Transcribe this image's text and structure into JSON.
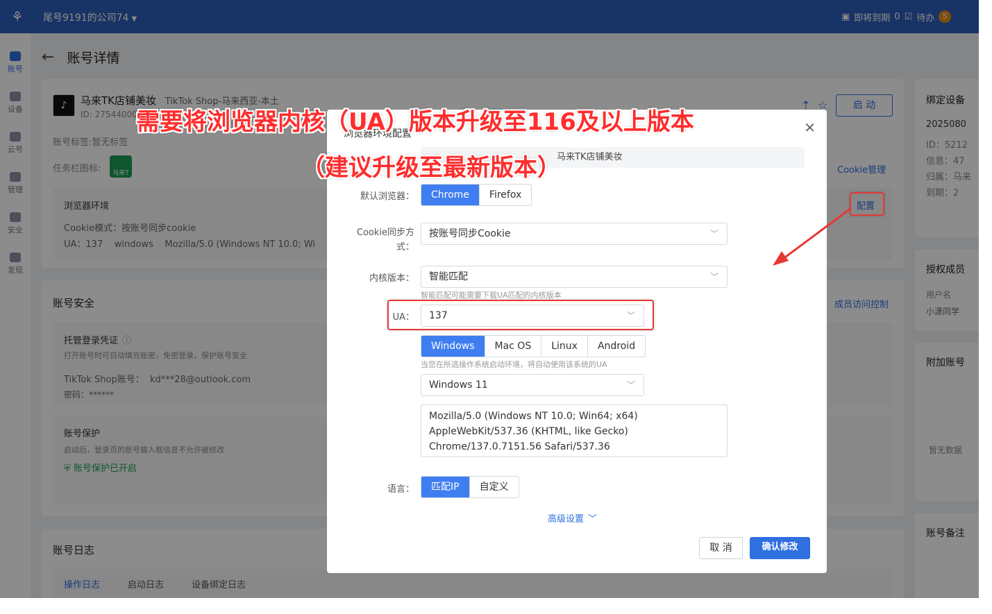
{
  "topbar": {
    "company": "尾号9191的公司74",
    "expiring_label": "即将到期",
    "expiring_count": "0",
    "todo_label": "待办",
    "todo_count": "5"
  },
  "sidenav": [
    {
      "label": "账号",
      "icon": "store-icon",
      "active": true
    },
    {
      "label": "设备",
      "icon": "device-icon",
      "active": false
    },
    {
      "label": "云号",
      "icon": "cloud-icon",
      "active": false
    },
    {
      "label": "管理",
      "icon": "manage-icon",
      "active": false
    },
    {
      "label": "安全",
      "icon": "security-icon",
      "active": false
    },
    {
      "label": "发现",
      "icon": "discover-icon",
      "active": false
    }
  ],
  "page": {
    "title": "账号详情"
  },
  "account_card": {
    "name": "马来TK店铺美妆",
    "platform": "TikTok Shop-马来西亚-本土",
    "id_text": "ID: 2754400072",
    "tags_text": "账号标签:暂无标签",
    "taskbar_label": "任务栏图标:",
    "taskbar_badge": "马来T",
    "start_label": "启 动",
    "cookie_mgmt": "Cookie管理",
    "browser_env": {
      "title": "浏览器环境",
      "config_link": "配置",
      "cookie_mode": "Cookie模式：按账号同步cookie",
      "ua_summary": "UA：137    windows    Mozilla/5.0 (Windows NT 10.0; Wi"
    }
  },
  "security_card": {
    "title": "账号安全",
    "access_control": "成员访问控制",
    "hosted": {
      "title": "托管登录凭证",
      "desc": "打开账号时可自动填充账密，免密登录，保护账号安全",
      "account_line": "TikTok Shop账号：  kd***28@outlook.com",
      "password_line": "密码：******"
    },
    "protect": {
      "title": "账号保护",
      "desc": "启动后，登录页的账号输入框信息不允许被修改",
      "status": "账号保护已开启"
    }
  },
  "log_card": {
    "title": "账号日志",
    "tabs": [
      "操作日志",
      "启动日志",
      "设备绑定日志"
    ]
  },
  "right_panels": {
    "bind": {
      "title": "绑定设备",
      "serial": "2025080",
      "id": "ID：5212",
      "info": "信息：47",
      "owner": "归属：马来",
      "expire": "到期：2"
    },
    "auth": {
      "title": "授权成员",
      "user_col": "用户名",
      "user": "小潇同学"
    },
    "extra": {
      "title": "附加账号",
      "empty": "暂无数据"
    },
    "note": {
      "title": "账号备注"
    }
  },
  "modal": {
    "title": "浏览器环境配置",
    "account_name": "马来TK店铺美妆",
    "default_browser_label": "默认浏览器：",
    "browsers": [
      "Chrome",
      "Firefox"
    ],
    "cookie_sync_label_1": "Cookie同步方",
    "cookie_sync_label_2": "式：",
    "cookie_sync_value": "按账号同步Cookie",
    "kernel_label": "内核版本：",
    "kernel_value": "智能匹配",
    "kernel_hint": "智能匹配可能需要下载UA匹配的内核版本",
    "ua_label": "UA：",
    "ua_value": "137",
    "os_options": [
      "Windows",
      "Mac OS",
      "Linux",
      "Android"
    ],
    "os_hint": "当您在所选操作系统启动环境，将自动使用该系统的UA",
    "os_version": "Windows 11",
    "ua_lines": [
      "Mozilla/5.0 (Windows NT 10.0; Win64; x64)",
      "AppleWebKit/537.36 (KHTML, like Gecko)",
      "Chrome/137.0.7151.56 Safari/537.36"
    ],
    "lang_label": "语言：",
    "lang_options": [
      "匹配IP",
      "自定义"
    ],
    "advanced": "高级设置",
    "cancel": "取 消",
    "confirm": "确认修改"
  },
  "annotation": {
    "line1": "需要将浏览器内核（UA）版本升级至116及以上版本",
    "line2": "（建议升级至最新版本）",
    "color": "#ff2d2d"
  }
}
